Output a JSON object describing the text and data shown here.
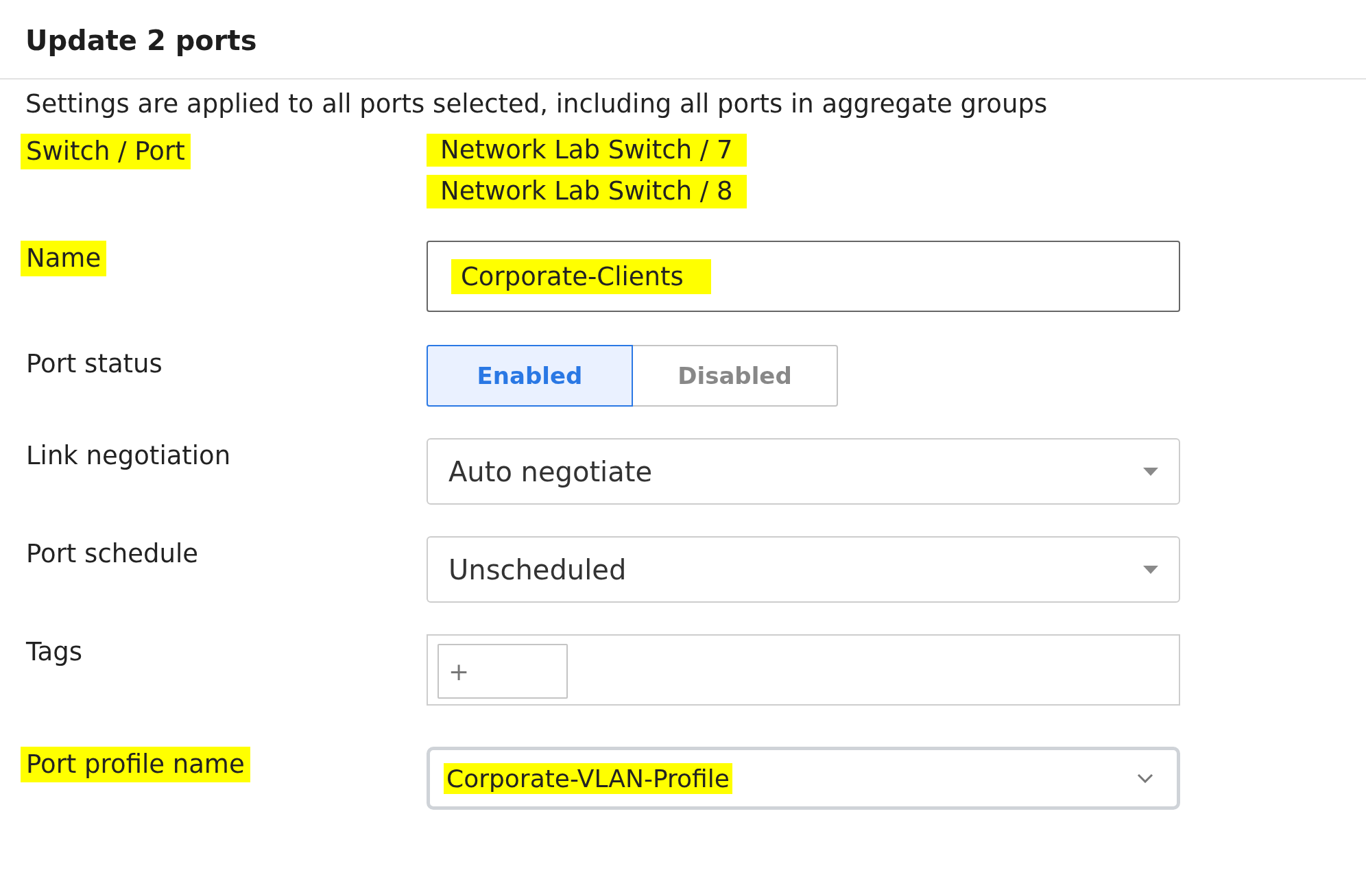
{
  "title": "Update 2 ports",
  "description": "Settings are applied to all ports selected, including all ports in aggregate groups",
  "fields": [
    {
      "kind": "text-list",
      "label": "Switch / Port",
      "label_highlighted": true,
      "values": [
        {
          "text": "Network Lab Switch / 7",
          "highlighted": true
        },
        {
          "text": "Network Lab Switch / 8",
          "highlighted": true
        }
      ]
    },
    {
      "kind": "input",
      "label": "Name",
      "label_highlighted": true,
      "value": "Corporate-Clients",
      "value_highlighted": true
    },
    {
      "kind": "toggle",
      "label": "Port status",
      "label_highlighted": false,
      "options": [
        {
          "label": "Enabled",
          "selected": true
        },
        {
          "label": "Disabled",
          "selected": false
        }
      ]
    },
    {
      "kind": "select",
      "label": "Link negotiation",
      "label_highlighted": false,
      "value": "Auto negotiate",
      "value_highlighted": false
    },
    {
      "kind": "select",
      "label": "Port schedule",
      "label_highlighted": false,
      "value": "Unscheduled",
      "value_highlighted": false
    },
    {
      "kind": "tags",
      "label": "Tags",
      "label_highlighted": false,
      "add": "+"
    },
    {
      "kind": "profile-select",
      "label": "Port profile name",
      "label_highlighted": true,
      "value": "Corporate-VLAN-Profile",
      "value_highlighted": true
    }
  ]
}
